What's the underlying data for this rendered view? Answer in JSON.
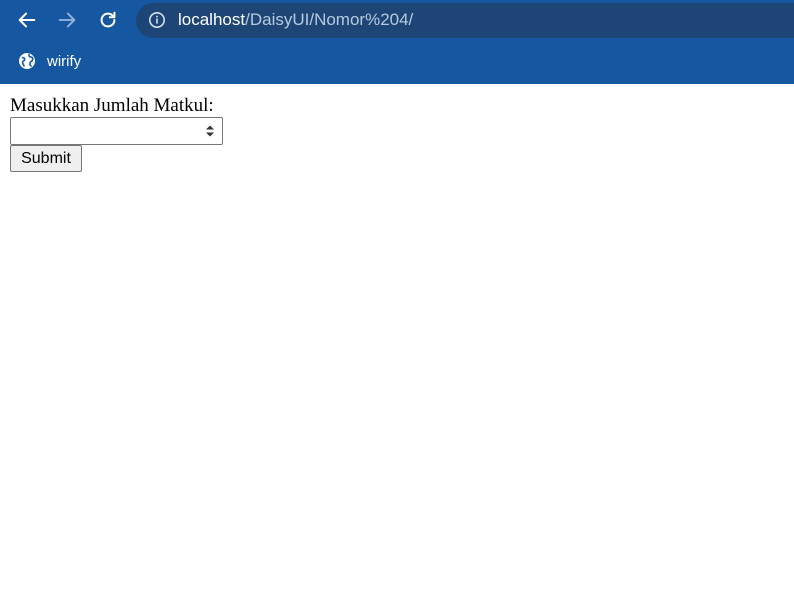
{
  "browser": {
    "url_host": "localhost",
    "url_path": "/DaisyUI/Nomor%204/",
    "bookmarks": [
      {
        "label": "wirify",
        "icon": "globe-icon"
      }
    ],
    "colors": {
      "toolbar": "#1557a0",
      "omnibox": "#1d4677"
    }
  },
  "form": {
    "label": "Masukkan Jumlah Matkul:",
    "input_value": "",
    "submit_label": "Submit"
  }
}
